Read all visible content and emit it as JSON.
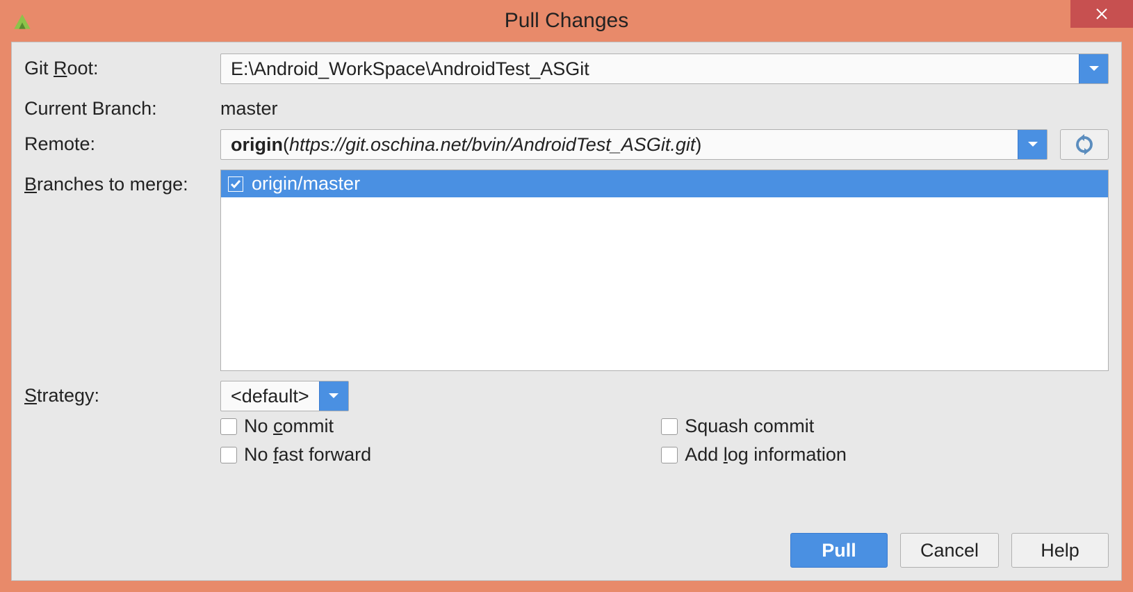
{
  "window": {
    "title": "Pull Changes"
  },
  "labels": {
    "git_root_pre": "Git ",
    "git_root_m": "R",
    "git_root_post": "oot:",
    "current_branch": "Current Branch:",
    "remote": "Remote:",
    "branches_m": "B",
    "branches_post": "ranches to merge:",
    "strategy_m": "S",
    "strategy_post": "trategy:"
  },
  "git_root": {
    "value": "E:\\Android_WorkSpace\\AndroidTest_ASGit"
  },
  "current_branch": {
    "value": "master"
  },
  "remote": {
    "name": "origin",
    "url": "https://git.oschina.net/bvin/AndroidTest_ASGit.git"
  },
  "branches": {
    "items": [
      {
        "label": "origin/master",
        "checked": true,
        "selected": true
      }
    ]
  },
  "strategy": {
    "value": "<default>"
  },
  "checks": {
    "no_commit_pre": "No ",
    "no_commit_m": "c",
    "no_commit_post": "ommit",
    "squash": "Squash commit",
    "nff_pre": "No ",
    "nff_m": "f",
    "nff_post": "ast forward",
    "addlog_pre": "Add ",
    "addlog_m": "l",
    "addlog_post": "og information"
  },
  "buttons": {
    "pull": "Pull",
    "cancel": "Cancel",
    "help": "Help"
  }
}
